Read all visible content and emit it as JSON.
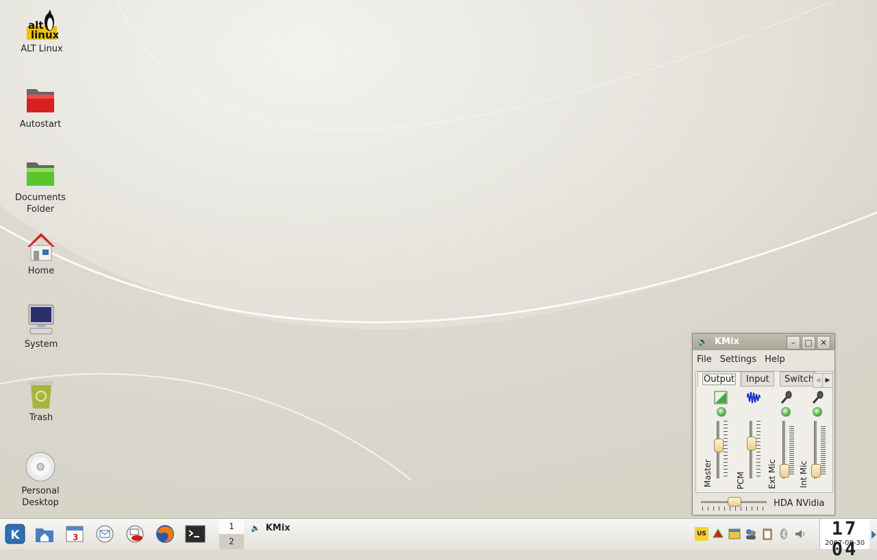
{
  "desktop": {
    "icons": [
      {
        "label": "ALT Linux",
        "icon": "alt-linux-logo"
      },
      {
        "label": "Autostart",
        "icon": "red-folder-icon"
      },
      {
        "label": "Documents\nFolder",
        "icon": "green-folder-icon"
      },
      {
        "label": "Home",
        "icon": "home-icon"
      },
      {
        "label": "System",
        "icon": "monitor-icon"
      },
      {
        "label": "Trash",
        "icon": "trash-icon"
      },
      {
        "label": "Personal\nDesktop",
        "icon": "cd-icon"
      }
    ],
    "logo_text": {
      "line1": "alt",
      "line2": "linux"
    }
  },
  "kmix": {
    "title": "KMix",
    "menu": [
      "File",
      "Settings",
      "Help"
    ],
    "tabs": [
      "Output",
      "Input",
      "Switch"
    ],
    "active_tab": "Output",
    "channels": [
      {
        "name": "Master",
        "icon": "volume-ramp-icon",
        "level": 0.6
      },
      {
        "name": "PCM",
        "icon": "waveform-icon",
        "level": 0.65
      },
      {
        "name": "Ext Mic",
        "icon": "microphone-icon",
        "level": 0.05
      },
      {
        "name": "Int Mic",
        "icon": "microphone-icon",
        "level": 0.05
      }
    ],
    "device": "HDA NVidia",
    "balance": 0.5
  },
  "taskbar": {
    "launchers": [
      "kde-menu-icon",
      "home-folder-icon",
      "calendar-icon",
      "mail-icon",
      "mail-client-icon",
      "firefox-icon",
      "terminal-icon"
    ],
    "calendar_day": "3",
    "pager": [
      "1",
      "2"
    ],
    "task": "KMix",
    "keyboard_layout": "US",
    "clock": {
      "time": "17 04",
      "date": "2007-08-30"
    }
  },
  "colors": {
    "titlebar": "#a8a597",
    "panel": "#e6e4dd",
    "led": "#58bd4f",
    "accent": "#d21a1a"
  }
}
